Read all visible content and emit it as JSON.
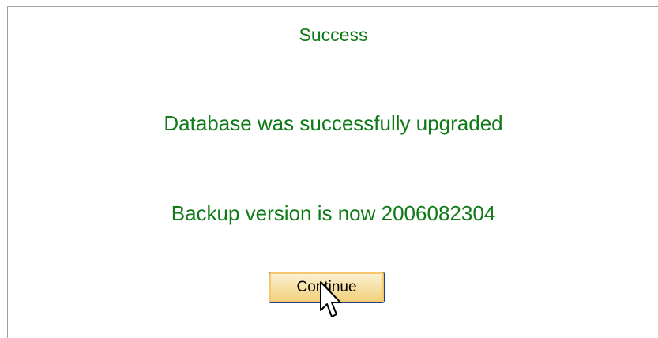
{
  "dialog": {
    "title": "Success",
    "message": "Database was successfully upgraded",
    "version_message": "Backup version is now 2006082304",
    "continue_label": "Continue"
  },
  "colors": {
    "message_text": "#0f7a17",
    "panel_border": "#a0a0a0",
    "button_border": "#1c3f94",
    "button_fill": "#f7e2aa"
  },
  "icons": {
    "cursor": "mouse-pointer-icon"
  }
}
